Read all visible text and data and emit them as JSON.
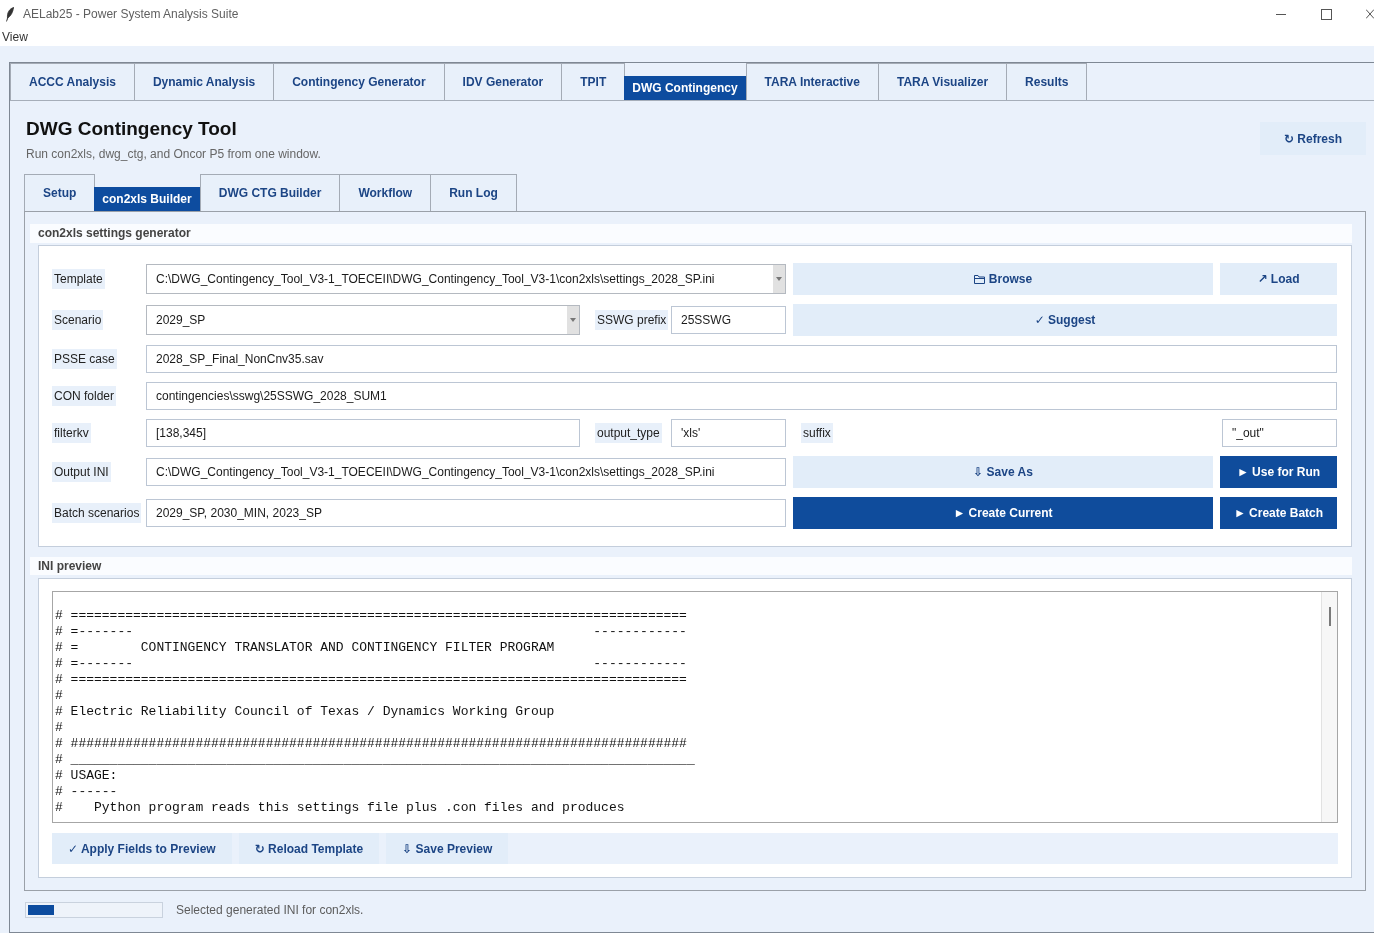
{
  "window": {
    "title": "AELab25 - Power System Analysis Suite"
  },
  "menu": [
    {
      "label": "View"
    }
  ],
  "tabs": [
    {
      "label": "ACCC Analysis",
      "selected": false
    },
    {
      "label": "Dynamic Analysis",
      "selected": false
    },
    {
      "label": "Contingency Generator",
      "selected": false
    },
    {
      "label": "IDV Generator",
      "selected": false
    },
    {
      "label": "TPIT",
      "selected": false
    },
    {
      "label": "DWG Contingency",
      "selected": true
    },
    {
      "label": "TARA Interactive",
      "selected": false
    },
    {
      "label": "TARA Visualizer",
      "selected": false
    },
    {
      "label": "Results",
      "selected": false
    }
  ],
  "page": {
    "title": "DWG Contingency Tool",
    "subtitle": "Run con2xls, dwg_ctg, and Oncor P5 from one window.",
    "refresh_button": "↻ Refresh"
  },
  "subtabs": [
    {
      "label": "Setup",
      "selected": false
    },
    {
      "label": "con2xls Builder",
      "selected": true
    },
    {
      "label": "DWG CTG Builder",
      "selected": false
    },
    {
      "label": "Workflow",
      "selected": false
    },
    {
      "label": "Run Log",
      "selected": false
    }
  ],
  "settings": {
    "title": "con2xls settings generator",
    "rows": [
      {
        "items": [
          {
            "kind": "label",
            "text": "Template"
          },
          {
            "kind": "combo",
            "value": "C:\\DWG_Contingency_Tool_V3-1_TOECEII\\DWG_Contingency_Tool_V3-1\\con2xls\\settings_2028_SP.ini"
          },
          {
            "kind": "browse",
            "text": "Browse"
          },
          {
            "kind": "button",
            "text": "↗ Load"
          }
        ]
      },
      {
        "items": [
          {
            "kind": "label",
            "text": "Scenario"
          },
          {
            "kind": "combo",
            "value": "2029_SP"
          },
          {
            "kind": "label",
            "text": "SSWG prefix"
          },
          {
            "kind": "input",
            "value": "25SSWG"
          },
          {
            "kind": "button",
            "text": "✓ Suggest"
          }
        ]
      },
      {
        "items": [
          {
            "kind": "label",
            "text": "PSSE case"
          },
          {
            "kind": "input",
            "value": "2028_SP_Final_NonCnv35.sav"
          }
        ]
      },
      {
        "items": [
          {
            "kind": "label",
            "text": "CON folder"
          },
          {
            "kind": "input",
            "value": "contingencies\\sswg\\25SSWG_2028_SUM1"
          }
        ]
      },
      {
        "items": [
          {
            "kind": "label",
            "text": "filterkv"
          },
          {
            "kind": "input",
            "value": "[138,345]"
          },
          {
            "kind": "label",
            "text": "output_type"
          },
          {
            "kind": "input",
            "value": "'xls'"
          },
          {
            "kind": "label",
            "text": "suffix"
          },
          {
            "kind": "input",
            "value": "\"_out\""
          }
        ]
      },
      {
        "items": [
          {
            "kind": "label",
            "text": "Output INI"
          },
          {
            "kind": "input",
            "value": "C:\\DWG_Contingency_Tool_V3-1_TOECEII\\DWG_Contingency_Tool_V3-1\\con2xls\\settings_2028_SP.ini"
          },
          {
            "kind": "button",
            "text": "⇩ Save As"
          },
          {
            "kind": "primary",
            "text": "► Use for Run"
          }
        ]
      },
      {
        "items": [
          {
            "kind": "label",
            "text": "Batch scenarios"
          },
          {
            "kind": "input",
            "value": "2029_SP, 2030_MIN, 2023_SP"
          },
          {
            "kind": "primary",
            "text": "► Create Current"
          },
          {
            "kind": "primary",
            "text": "► Create Batch"
          }
        ]
      }
    ]
  },
  "preview": {
    "title": "INI preview",
    "lines": [
      "# ===============================================================================",
      "# =-------                                                           ------------",
      "# =        CONTINGENCY TRANSLATOR AND CONTINGENCY FILTER PROGRAM",
      "# =-------                                                           ------------",
      "# ===============================================================================",
      "#",
      "# Electric Reliability Council of Texas / Dynamics Working Group",
      "#",
      "# ###############################################################################",
      "# ________________________________________________________________________________",
      "# USAGE:",
      "# ------",
      "#    Python program reads this settings file plus .con files and produces"
    ],
    "buttons": [
      "✓ Apply Fields to Preview",
      "↻ Reload Template",
      "⇩ Save Preview"
    ]
  },
  "status": {
    "level": 0.2,
    "text": "Selected generated INI for con2xls."
  }
}
